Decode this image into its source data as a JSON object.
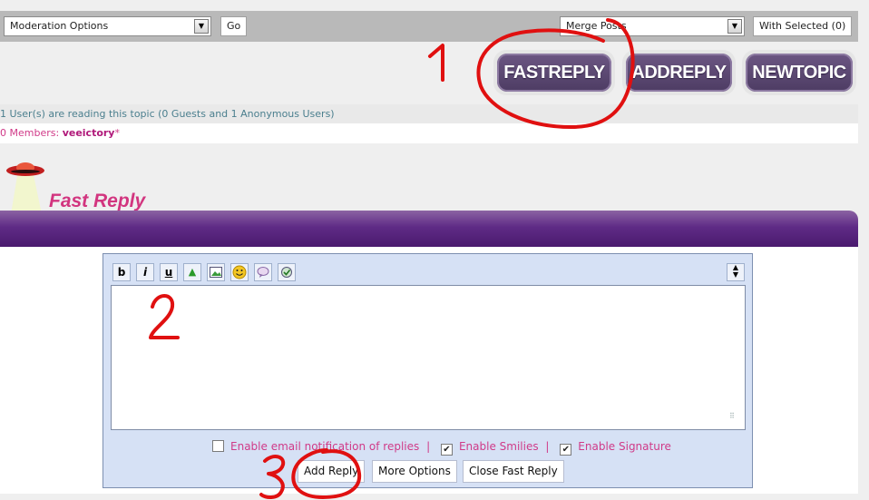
{
  "modbar": {
    "moderation_select": "Moderation Options",
    "go_button": "Go",
    "merge_select": "Merge Posts",
    "with_selected_button": "With Selected (0)"
  },
  "action_buttons": {
    "fastreply": "FASTREPLY",
    "addreply": "ADDREPLY",
    "newtopic": "NEWTOPIC"
  },
  "presence": {
    "readers": "1 User(s) are reading this topic (0 Guests and 1 Anonymous Users)",
    "members_prefix": "0 Members:",
    "member_name": "veeictory",
    "member_suffix": "*"
  },
  "fast_reply": {
    "title": "Fast Reply",
    "toolbar": [
      {
        "icon": "bold-icon",
        "glyph": "b"
      },
      {
        "icon": "italic-icon",
        "glyph": "i"
      },
      {
        "icon": "underline-icon",
        "glyph": "u"
      },
      {
        "icon": "insert-link-icon",
        "glyph": "🔗"
      },
      {
        "icon": "insert-image-icon",
        "glyph": "🖼"
      },
      {
        "icon": "smiley-icon",
        "glyph": "☺"
      },
      {
        "icon": "quote-icon",
        "glyph": "💬"
      },
      {
        "icon": "spellcheck-icon",
        "glyph": "✓"
      }
    ],
    "textarea_value": "",
    "options": {
      "email_notification": "Enable email notification of replies",
      "email_checked": false,
      "smilies": "Enable Smilies",
      "smilies_checked": true,
      "signature": "Enable Signature",
      "signature_checked": true,
      "separator": "|"
    },
    "buttons": {
      "add_reply": "Add Reply",
      "more_options": "More Options",
      "close_fast_reply": "Close Fast Reply"
    }
  },
  "annotations": [
    "1",
    "2",
    "3"
  ],
  "colors": {
    "pill_purple": "#5a4872",
    "header_purple": "#5f2b86",
    "pink_text": "#d03a88",
    "annotation_red": "#e01010"
  }
}
